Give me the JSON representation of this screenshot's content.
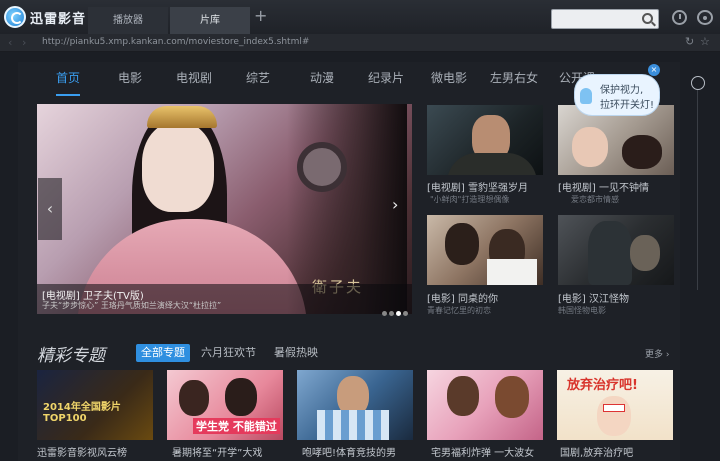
{
  "app": {
    "name": "迅雷影音"
  },
  "tabs": [
    {
      "label": "播放器"
    },
    {
      "label": "片库"
    }
  ],
  "urlbar": {
    "url": "http://pianku5.xmp.kankan.com/moviestore_index5.shtml#"
  },
  "categories": [
    "首页",
    "电影",
    "电视剧",
    "综艺",
    "动漫",
    "纪录片",
    "微电影",
    "左男右女",
    "公开课"
  ],
  "hero": {
    "title": "[电视剧] 卫子夫(TV版)",
    "subtitle": "子夫“步步惊心” 王珞丹气质如兰演绎大汉“杜拉拉”",
    "watermark": "衛子夫"
  },
  "side_items": [
    {
      "title": "[电视剧] 雪豹坚强岁月",
      "sub": "\"小鲜肉\"打造理想偶像"
    },
    {
      "title": "[电视剧] 一见不钟情",
      "sub": "爱恋都市情感"
    },
    {
      "title": "[电影] 同桌的你",
      "sub": "青春记忆里的初恋"
    },
    {
      "title": "[电影] 汉江怪物",
      "sub": "韩国怪物电影"
    }
  ],
  "tip": {
    "line1": "保护视力,",
    "line2": "拉环开关灯!"
  },
  "section": {
    "title": "精彩专题",
    "chips": [
      "全部专题",
      "六月狂欢节",
      "暑假热映"
    ],
    "more": "更多 ›"
  },
  "bottom_items": [
    {
      "title": "迅雷影音影视风云榜"
    },
    {
      "title": "暑期将至“开学”大戏"
    },
    {
      "title": "咆哮吧!体育竞技的男"
    },
    {
      "title": "宅男福利炸弹 一大波女"
    },
    {
      "title": "国剧,放弃治疗吧"
    }
  ],
  "poster_texts": {
    "bottom1": "2014年全国影片TOP100",
    "bottom2": "学生党 不能错过",
    "bottom5": "放弃治疗吧!"
  },
  "colors": {
    "accent": "#2f8fe0",
    "background": "#1b1e24"
  }
}
